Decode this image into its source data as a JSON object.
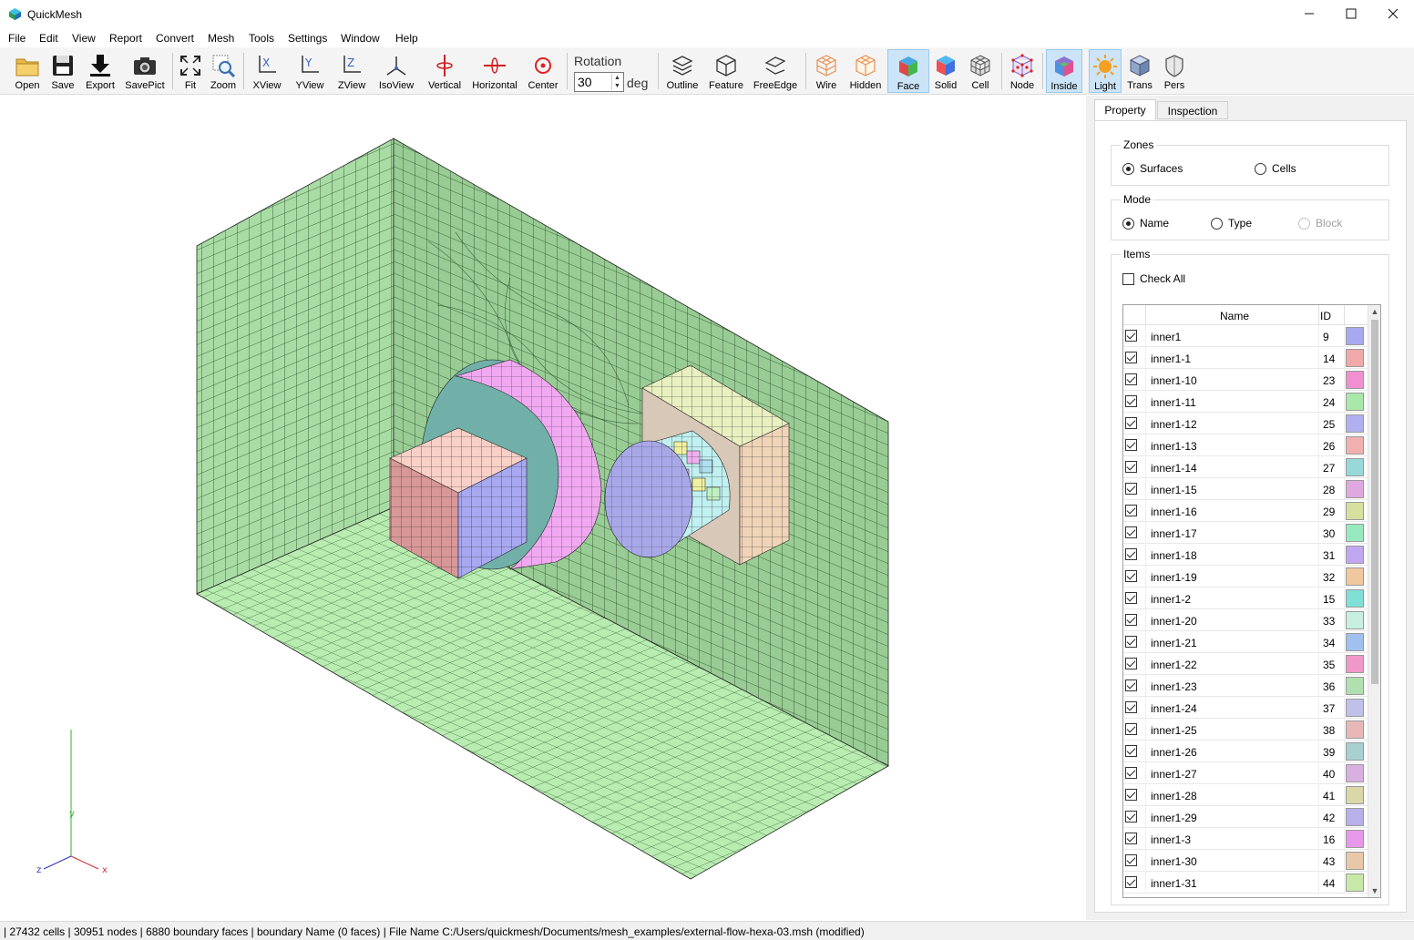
{
  "window": {
    "title": "QuickMesh",
    "minimize_icon": "minimize-icon",
    "maximize_icon": "maximize-icon",
    "close_icon": "close-icon"
  },
  "menu": [
    "File",
    "Edit",
    "View",
    "Report",
    "Convert",
    "Mesh",
    "Tools",
    "Settings",
    "Window",
    "Help"
  ],
  "toolbar": {
    "open": "Open",
    "save": "Save",
    "export": "Export",
    "savepict": "SavePict",
    "fit": "Fit",
    "zoom": "Zoom",
    "xview": "XView",
    "yview": "YView",
    "zview": "ZView",
    "isoview": "IsoView",
    "vertical": "Vertical",
    "horizontal": "Horizontal",
    "center": "Center",
    "rotation_label": "Rotation",
    "rotation_value": "30",
    "deg": "deg",
    "outline": "Outline",
    "feature": "Feature",
    "freeedge": "FreeEdge",
    "wire": "Wire",
    "hidden": "Hidden",
    "face": "Face",
    "solid": "Solid",
    "cell": "Cell",
    "node": "Node",
    "inside": "Inside",
    "light": "Light",
    "trans": "Trans",
    "pers": "Pers"
  },
  "axes": {
    "x": "x",
    "y": "y",
    "z": "z"
  },
  "panel": {
    "tabs": [
      "Property",
      "Inspection"
    ],
    "zones": {
      "title": "Zones",
      "surfaces": "Surfaces",
      "cells": "Cells"
    },
    "mode": {
      "title": "Mode",
      "name": "Name",
      "type": "Type",
      "block": "Block"
    },
    "items": {
      "title": "Items",
      "check_all": "Check All",
      "col_name": "Name",
      "col_id": "ID",
      "rows": [
        {
          "name": "inner1",
          "id": "9",
          "color": "#a8a8f0"
        },
        {
          "name": "inner1-1",
          "id": "14",
          "color": "#f0a8a8"
        },
        {
          "name": "inner1-10",
          "id": "23",
          "color": "#f090d0"
        },
        {
          "name": "inner1-11",
          "id": "24",
          "color": "#a8e8a8"
        },
        {
          "name": "inner1-12",
          "id": "25",
          "color": "#b0b0f0"
        },
        {
          "name": "inner1-13",
          "id": "26",
          "color": "#f0b0b0"
        },
        {
          "name": "inner1-14",
          "id": "27",
          "color": "#98d8d8"
        },
        {
          "name": "inner1-15",
          "id": "28",
          "color": "#e0a8e0"
        },
        {
          "name": "inner1-16",
          "id": "29",
          "color": "#d8e0a0"
        },
        {
          "name": "inner1-17",
          "id": "30",
          "color": "#98e8c0"
        },
        {
          "name": "inner1-18",
          "id": "31",
          "color": "#c0a8f0"
        },
        {
          "name": "inner1-19",
          "id": "32",
          "color": "#f0c8a0"
        },
        {
          "name": "inner1-2",
          "id": "15",
          "color": "#80e0d8"
        },
        {
          "name": "inner1-20",
          "id": "33",
          "color": "#c8f0e0"
        },
        {
          "name": "inner1-21",
          "id": "34",
          "color": "#a0c0f0"
        },
        {
          "name": "inner1-22",
          "id": "35",
          "color": "#f098c8"
        },
        {
          "name": "inner1-23",
          "id": "36",
          "color": "#b0e0b0"
        },
        {
          "name": "inner1-24",
          "id": "37",
          "color": "#c0c0e8"
        },
        {
          "name": "inner1-25",
          "id": "38",
          "color": "#e8b8b8"
        },
        {
          "name": "inner1-26",
          "id": "39",
          "color": "#a8d0d0"
        },
        {
          "name": "inner1-27",
          "id": "40",
          "color": "#d8b0e0"
        },
        {
          "name": "inner1-28",
          "id": "41",
          "color": "#d8d8a8"
        },
        {
          "name": "inner1-29",
          "id": "42",
          "color": "#b8b0e8"
        },
        {
          "name": "inner1-3",
          "id": "16",
          "color": "#e898e8"
        },
        {
          "name": "inner1-30",
          "id": "43",
          "color": "#e8c8a8"
        },
        {
          "name": "inner1-31",
          "id": "44",
          "color": "#c8e8a8"
        }
      ]
    }
  },
  "status": "| 27432 cells | 30951 nodes | 6880 boundary faces |  boundary Name  (0 faces) | File Name C:/Users/quickmesh/Documents/mesh_examples/external-flow-hexa-03.msh (modified)"
}
